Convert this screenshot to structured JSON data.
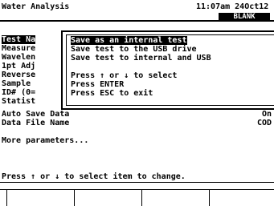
{
  "header": {
    "title": "Water Analysis",
    "time": "11:07am 24Oct12",
    "mode": "BLANK"
  },
  "params": [
    {
      "label": "Test Na",
      "value": ""
    },
    {
      "label": "Measure",
      "value": ""
    },
    {
      "label": "Wavelen",
      "value": ""
    },
    {
      "label": "1pt Adj",
      "value": ""
    },
    {
      "label": "Reverse",
      "value": ""
    },
    {
      "label": "Sample",
      "value": ""
    },
    {
      "label": "ID# (0=",
      "value": ""
    },
    {
      "label": "Statist",
      "value": ""
    },
    {
      "label": "Auto Save Data",
      "value": "On"
    },
    {
      "label": "Data File Name",
      "value": "COD"
    }
  ],
  "more": "More parameters...",
  "popup": {
    "options": [
      "Save as an internal test",
      "Save test to the USB drive",
      "Save test to internal and USB"
    ],
    "help": [
      "Press ↑ or ↓ to select",
      "Press ENTER",
      "Press ESC to exit"
    ]
  },
  "status": "Press ↑ or ↓ to select item to change.",
  "softkeys": [
    "",
    "",
    "",
    ""
  ]
}
